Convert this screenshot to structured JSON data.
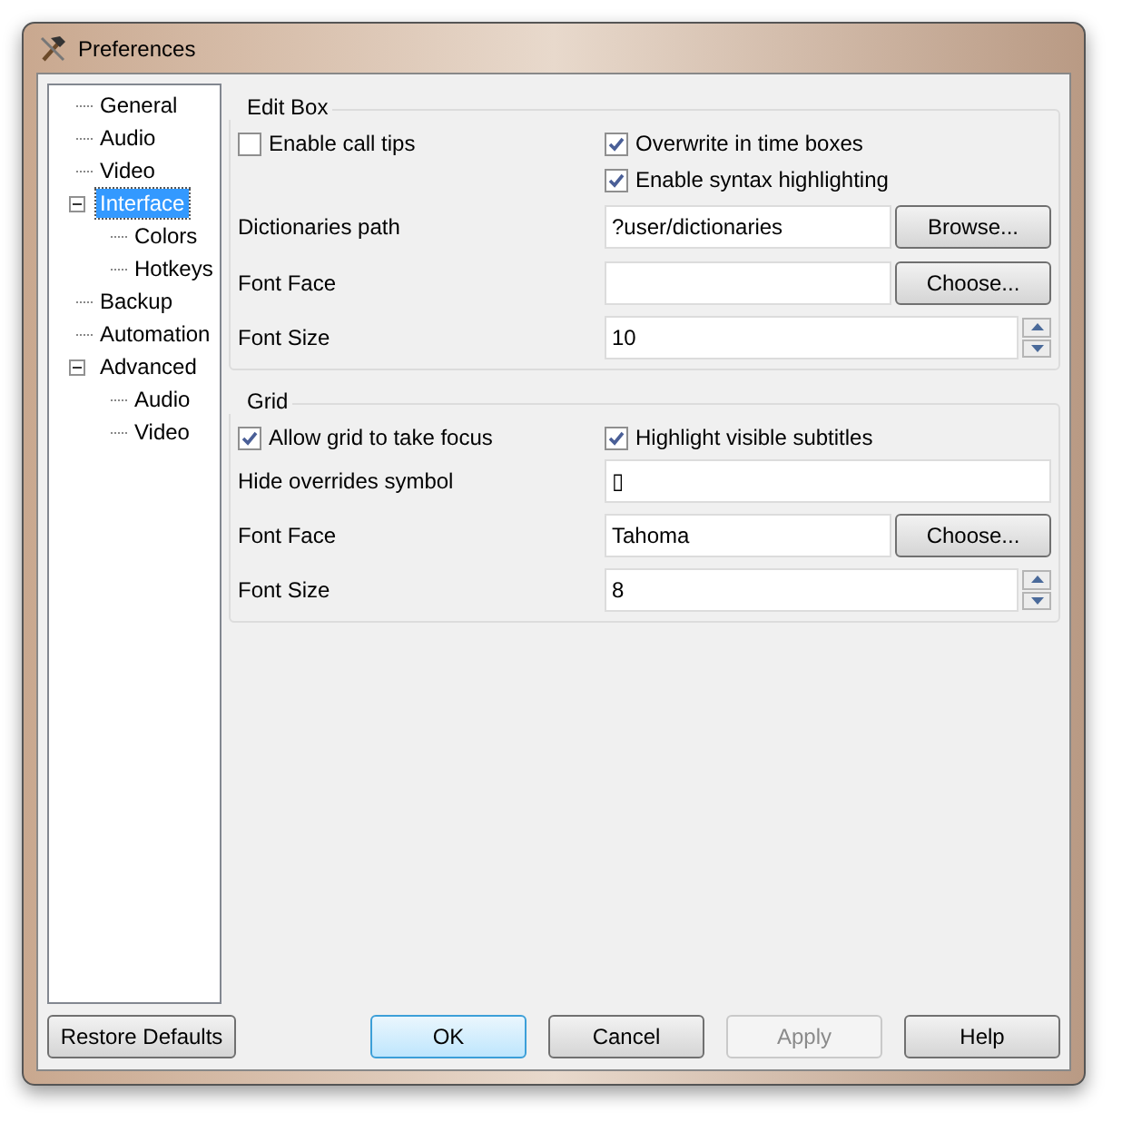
{
  "window": {
    "title": "Preferences"
  },
  "tree": [
    {
      "label": "General",
      "selected": false
    },
    {
      "label": "Audio",
      "selected": false
    },
    {
      "label": "Video",
      "selected": false
    },
    {
      "label": "Interface",
      "selected": true,
      "expanded": true,
      "children": [
        {
          "label": "Colors",
          "selected": false
        },
        {
          "label": "Hotkeys",
          "selected": false
        }
      ]
    },
    {
      "label": "Backup",
      "selected": false
    },
    {
      "label": "Automation",
      "selected": false
    },
    {
      "label": "Advanced",
      "selected": false,
      "expanded": true,
      "children": [
        {
          "label": "Audio",
          "selected": false
        },
        {
          "label": "Video",
          "selected": false
        }
      ]
    }
  ],
  "groups": [
    {
      "title": "Edit Box",
      "rows": [
        {
          "kind": "checks",
          "left": {
            "label": "Enable call tips",
            "checked": false
          },
          "right": {
            "label": "Overwrite in time boxes",
            "checked": true
          }
        },
        {
          "kind": "checks",
          "right": {
            "label": "Enable syntax highlighting",
            "checked": true
          }
        },
        {
          "kind": "field_button",
          "label": "Dictionaries path",
          "value": "?user/dictionaries",
          "button": "Browse..."
        },
        {
          "kind": "field_button",
          "label": "Font Face",
          "button": "Choose..."
        },
        {
          "kind": "spin",
          "label": "Font Size",
          "value": "10"
        }
      ]
    },
    {
      "title": "Grid",
      "rows": [
        {
          "kind": "checks",
          "left": {
            "label": "Allow grid to take focus",
            "checked": true
          },
          "right": {
            "label": "Highlight visible subtitles",
            "checked": true
          }
        },
        {
          "kind": "field",
          "label": "Hide overrides symbol",
          "value": "▯"
        },
        {
          "kind": "field_button",
          "label": "Font Face",
          "value": "Tahoma",
          "button": "Choose..."
        },
        {
          "kind": "spin",
          "label": "Font Size",
          "value": "8"
        }
      ]
    }
  ],
  "left_buttons": [
    {
      "label": "Restore Defaults",
      "disabled": false
    }
  ],
  "buttons": [
    {
      "label": "OK",
      "default": true,
      "disabled": false
    },
    {
      "label": "Cancel",
      "default": false,
      "disabled": false
    },
    {
      "label": "Apply",
      "default": false,
      "disabled": true
    },
    {
      "label": "Help",
      "default": false,
      "disabled": false
    }
  ]
}
